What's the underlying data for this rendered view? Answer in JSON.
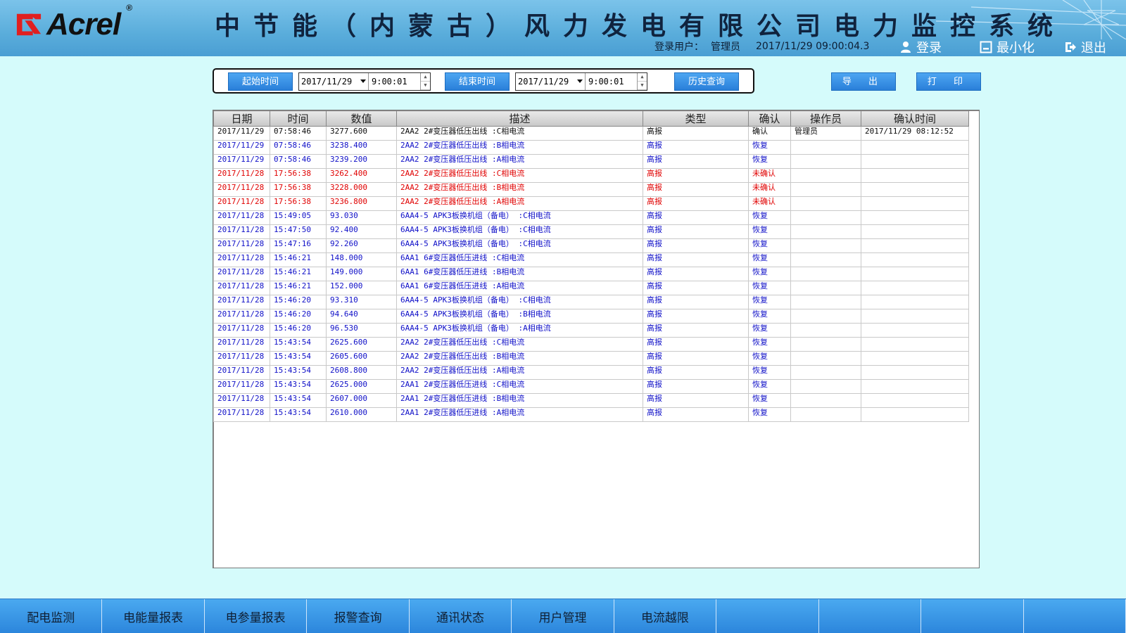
{
  "header": {
    "brand": "Acrel",
    "registered": "®",
    "title": "中节能（内蒙古）风力发电有限公司电力监控系统",
    "login_label": "登录用户：",
    "login_user": "管理员",
    "datetime": "2017/11/29  09:00:04.3",
    "login_button": "登录",
    "minimize_button": "最小化",
    "exit_button": "退出"
  },
  "query": {
    "start_label": "起始时间",
    "start_date": "2017/11/29",
    "start_time": "9:00:01",
    "end_label": "结束时间",
    "end_date": "2017/11/29",
    "end_time": "9:00:01",
    "search_label": "历史查询",
    "export_label": "导 出",
    "print_label": "打 印"
  },
  "table": {
    "columns": [
      "日期",
      "时间",
      "数值",
      "描述",
      "类型",
      "确认",
      "操作员",
      "确认时间"
    ],
    "rows": [
      {
        "date": "2017/11/29",
        "time": "07:58:46",
        "value": "3277.600",
        "desc": "2AA2 2#变压器低压出线 :C相电流",
        "type": "高报",
        "confirm": "确认",
        "operator": "管理员",
        "confirm_time": "2017/11/29 08:12:52",
        "status": "normal"
      },
      {
        "date": "2017/11/29",
        "time": "07:58:46",
        "value": "3238.400",
        "desc": "2AA2 2#变压器低压出线 :B相电流",
        "type": "高报",
        "confirm": "恢复",
        "operator": "",
        "confirm_time": "",
        "status": "recovered"
      },
      {
        "date": "2017/11/29",
        "time": "07:58:46",
        "value": "3239.200",
        "desc": "2AA2 2#变压器低压出线 :A相电流",
        "type": "高报",
        "confirm": "恢复",
        "operator": "",
        "confirm_time": "",
        "status": "recovered"
      },
      {
        "date": "2017/11/28",
        "time": "17:56:38",
        "value": "3262.400",
        "desc": "2AA2 2#变压器低压出线 :C相电流",
        "type": "高报",
        "confirm": "未确认",
        "operator": "",
        "confirm_time": "",
        "status": "unconfirmed"
      },
      {
        "date": "2017/11/28",
        "time": "17:56:38",
        "value": "3228.000",
        "desc": "2AA2 2#变压器低压出线 :B相电流",
        "type": "高报",
        "confirm": "未确认",
        "operator": "",
        "confirm_time": "",
        "status": "unconfirmed"
      },
      {
        "date": "2017/11/28",
        "time": "17:56:38",
        "value": "3236.800",
        "desc": "2AA2 2#变压器低压出线 :A相电流",
        "type": "高报",
        "confirm": "未确认",
        "operator": "",
        "confirm_time": "",
        "status": "unconfirmed"
      },
      {
        "date": "2017/11/28",
        "time": "15:49:05",
        "value": "93.030",
        "desc": "6AA4-5 APK3板换机组（备电） :C相电流",
        "type": "高报",
        "confirm": "恢复",
        "operator": "",
        "confirm_time": "",
        "status": "recovered"
      },
      {
        "date": "2017/11/28",
        "time": "15:47:50",
        "value": "92.400",
        "desc": "6AA4-5 APK3板换机组（备电） :C相电流",
        "type": "高报",
        "confirm": "恢复",
        "operator": "",
        "confirm_time": "",
        "status": "recovered"
      },
      {
        "date": "2017/11/28",
        "time": "15:47:16",
        "value": "92.260",
        "desc": "6AA4-5 APK3板换机组（备电） :C相电流",
        "type": "高报",
        "confirm": "恢复",
        "operator": "",
        "confirm_time": "",
        "status": "recovered"
      },
      {
        "date": "2017/11/28",
        "time": "15:46:21",
        "value": "148.000",
        "desc": "6AA1 6#变压器低压进线 :C相电流",
        "type": "高报",
        "confirm": "恢复",
        "operator": "",
        "confirm_time": "",
        "status": "recovered"
      },
      {
        "date": "2017/11/28",
        "time": "15:46:21",
        "value": "149.000",
        "desc": "6AA1 6#变压器低压进线 :B相电流",
        "type": "高报",
        "confirm": "恢复",
        "operator": "",
        "confirm_time": "",
        "status": "recovered"
      },
      {
        "date": "2017/11/28",
        "time": "15:46:21",
        "value": "152.000",
        "desc": "6AA1 6#变压器低压进线 :A相电流",
        "type": "高报",
        "confirm": "恢复",
        "operator": "",
        "confirm_time": "",
        "status": "recovered"
      },
      {
        "date": "2017/11/28",
        "time": "15:46:20",
        "value": "93.310",
        "desc": "6AA4-5 APK3板换机组（备电） :C相电流",
        "type": "高报",
        "confirm": "恢复",
        "operator": "",
        "confirm_time": "",
        "status": "recovered"
      },
      {
        "date": "2017/11/28",
        "time": "15:46:20",
        "value": "94.640",
        "desc": "6AA4-5 APK3板换机组（备电） :B相电流",
        "type": "高报",
        "confirm": "恢复",
        "operator": "",
        "confirm_time": "",
        "status": "recovered"
      },
      {
        "date": "2017/11/28",
        "time": "15:46:20",
        "value": "96.530",
        "desc": "6AA4-5 APK3板换机组（备电） :A相电流",
        "type": "高报",
        "confirm": "恢复",
        "operator": "",
        "confirm_time": "",
        "status": "recovered"
      },
      {
        "date": "2017/11/28",
        "time": "15:43:54",
        "value": "2625.600",
        "desc": "2AA2 2#变压器低压出线 :C相电流",
        "type": "高报",
        "confirm": "恢复",
        "operator": "",
        "confirm_time": "",
        "status": "recovered"
      },
      {
        "date": "2017/11/28",
        "time": "15:43:54",
        "value": "2605.600",
        "desc": "2AA2 2#变压器低压出线 :B相电流",
        "type": "高报",
        "confirm": "恢复",
        "operator": "",
        "confirm_time": "",
        "status": "recovered"
      },
      {
        "date": "2017/11/28",
        "time": "15:43:54",
        "value": "2608.800",
        "desc": "2AA2 2#变压器低压出线 :A相电流",
        "type": "高报",
        "confirm": "恢复",
        "operator": "",
        "confirm_time": "",
        "status": "recovered"
      },
      {
        "date": "2017/11/28",
        "time": "15:43:54",
        "value": "2625.000",
        "desc": "2AA1 2#变压器低压进线 :C相电流",
        "type": "高报",
        "confirm": "恢复",
        "operator": "",
        "confirm_time": "",
        "status": "recovered"
      },
      {
        "date": "2017/11/28",
        "time": "15:43:54",
        "value": "2607.000",
        "desc": "2AA1 2#变压器低压进线 :B相电流",
        "type": "高报",
        "confirm": "恢复",
        "operator": "",
        "confirm_time": "",
        "status": "recovered"
      },
      {
        "date": "2017/11/28",
        "time": "15:43:54",
        "value": "2610.000",
        "desc": "2AA1 2#变压器低压进线 :A相电流",
        "type": "高报",
        "confirm": "恢复",
        "operator": "",
        "confirm_time": "",
        "status": "recovered"
      }
    ]
  },
  "nav": {
    "items": [
      "配电监测",
      "电能量报表",
      "电参量报表",
      "报警查询",
      "通讯状态",
      "用户管理",
      "电流越限",
      "",
      "",
      "",
      ""
    ]
  },
  "colors": {
    "background": "#d5fbfb",
    "header": "#5aaddb",
    "button": "#2a7fd9",
    "recovered_text": "#1010c8",
    "unconfirmed_text": "#e00000",
    "normal_text": "#0b0b0b",
    "logo_red": "#e02020"
  },
  "icons": {
    "login": "user-icon",
    "minimize": "minimize-icon",
    "exit": "exit-icon",
    "dropdown": "chevron-down-icon",
    "spinner": "spinner-icon"
  }
}
